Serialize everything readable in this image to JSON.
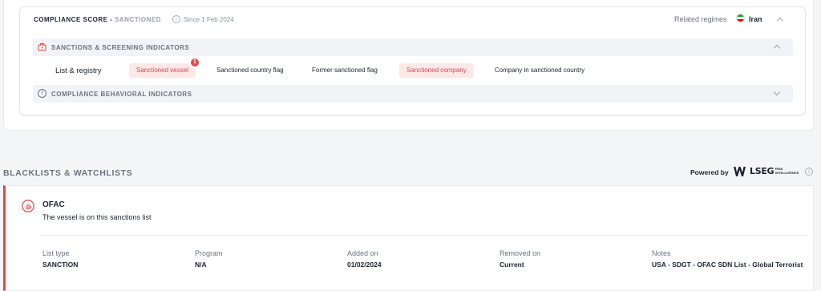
{
  "score": {
    "title": "COMPLIANCE SCORE",
    "separator": " - ",
    "status": "SANCTIONED",
    "since": "Since 1 Feb 2024",
    "info_glyph": "i",
    "regimes_label": "Related regimes",
    "regime": "Iran",
    "flag_icon": "iran-flag-icon"
  },
  "sanctions_section": {
    "title": "SANCTIONS & SCREENING INDICATORS",
    "icon": "building-alert-icon",
    "row_label": "List & registry",
    "tags": [
      {
        "label": "Sanctioned vessel",
        "flagged": true
      },
      {
        "label": "Sanctioned country flag",
        "flagged": false
      },
      {
        "label": "Former sanctioned flag",
        "flagged": false
      },
      {
        "label": "Sanctioned company",
        "flagged": true
      },
      {
        "label": "Company in sanctioned country",
        "flagged": false
      }
    ],
    "badge_count": "1",
    "flag_color": "#e0464b"
  },
  "behavioral_section": {
    "title": "COMPLIANCE BEHAVIORAL INDICATORS",
    "icon": "alert-circle-icon",
    "info_glyph": "!"
  },
  "blacklists": {
    "title": "BLACKLISTS & WATCHLISTS",
    "powered_by": "Powered by",
    "provider": "LSEG",
    "provider_sub": "RISK INTELLIGENCE",
    "info_glyph": "i"
  },
  "list_entry": {
    "name": "OFAC",
    "description": "The vessel is on this sanctions list",
    "icon": "hand-stop-icon",
    "fields": [
      {
        "label": "List type",
        "value": "SANCTION"
      },
      {
        "label": "Program",
        "value": "N/A"
      },
      {
        "label": "Added on",
        "value": "01/02/2024"
      },
      {
        "label": "Removed on",
        "value": "Current"
      },
      {
        "label": "Notes",
        "value": "USA - SDGT - OFAC SDN List - Global Terrorist"
      }
    ]
  },
  "colors": {
    "accent_red": "#e0464b",
    "flag_bg": "#fde8e8",
    "muted": "#6b7280"
  }
}
